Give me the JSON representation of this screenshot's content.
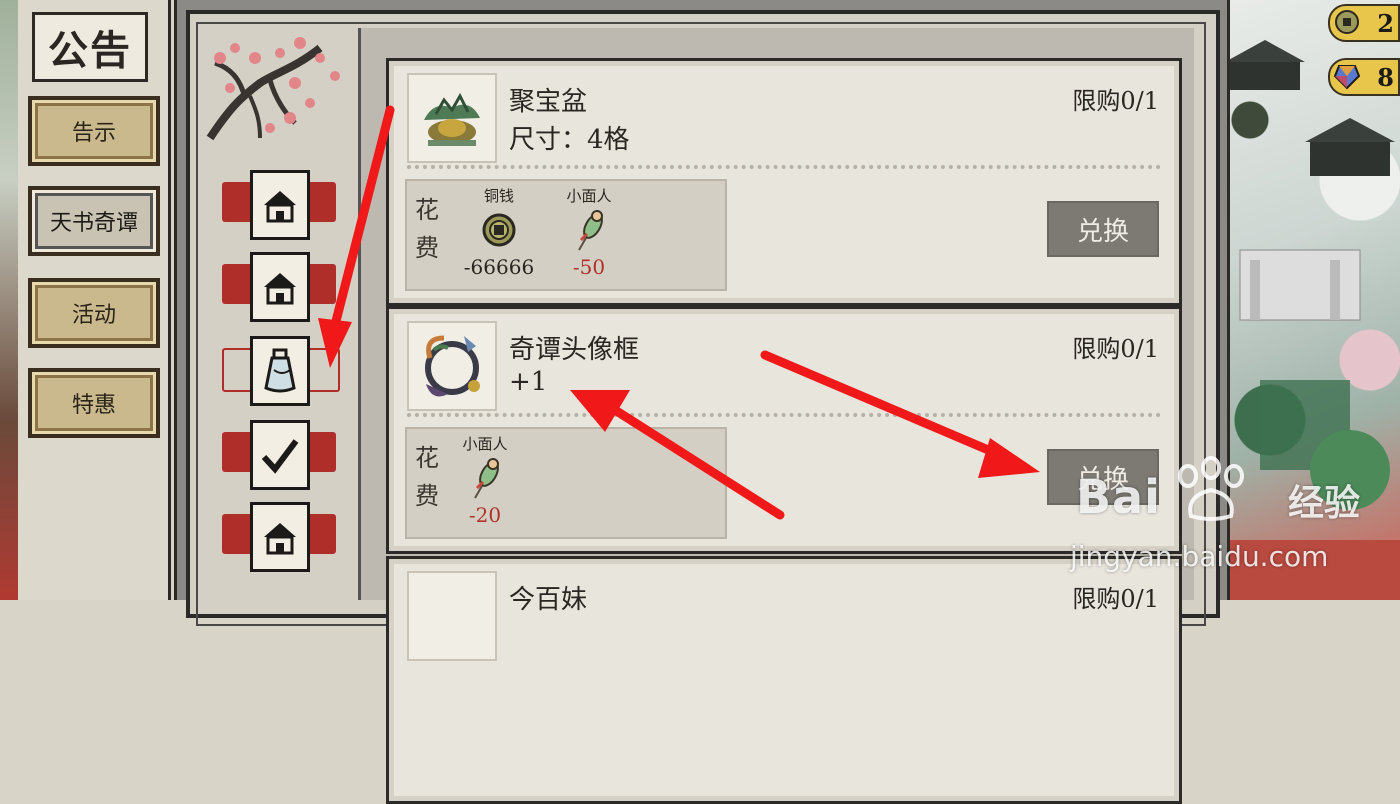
{
  "sidebar": {
    "title": "公告",
    "items": [
      {
        "label": "告示",
        "active": false
      },
      {
        "label": "天书奇谭",
        "active": true
      },
      {
        "label": "活动",
        "active": false
      },
      {
        "label": "特惠",
        "active": false
      }
    ]
  },
  "tabs": [
    {
      "icon": "house-icon",
      "selected": false
    },
    {
      "icon": "house-icon",
      "selected": false
    },
    {
      "icon": "bottle-icon",
      "selected": true
    },
    {
      "icon": "check-icon",
      "selected": false
    },
    {
      "icon": "house-icon",
      "selected": false
    }
  ],
  "shop_items": [
    {
      "name": "聚宝盆",
      "sub": "尺寸：4格",
      "limit": "限购0/1",
      "cost_label_1": "花",
      "cost_label_2": "费",
      "costs": [
        {
          "name": "铜钱",
          "icon": "coin-icon",
          "value": "-66666",
          "insufficient": false
        },
        {
          "name": "小面人",
          "icon": "dough-figure-icon",
          "value": "-50",
          "insufficient": true
        }
      ],
      "button": "兑换"
    },
    {
      "name": "奇谭头像框",
      "sub": "+1",
      "limit": "限购0/1",
      "cost_label_1": "花",
      "cost_label_2": "费",
      "costs": [
        {
          "name": "小面人",
          "icon": "dough-figure-icon",
          "value": "-20",
          "insufficient": true
        }
      ],
      "button": "兑换"
    },
    {
      "name": "今百妹",
      "sub": "",
      "limit": "限购0/1",
      "cost_label_1": "",
      "cost_label_2": "",
      "costs": [],
      "button": ""
    }
  ],
  "currencies": [
    {
      "icon": "coin-icon",
      "value": "2"
    },
    {
      "icon": "gem-icon",
      "value": "8"
    }
  ],
  "watermark": {
    "brand": "Bai",
    "brand2": "经验",
    "url": "jingyan.baidu.com"
  },
  "colors": {
    "annotation_arrow": "#f01818",
    "red_band": "#b02e2a",
    "insufficient_text": "#b03228",
    "exchange_button": "#7d7a74"
  }
}
